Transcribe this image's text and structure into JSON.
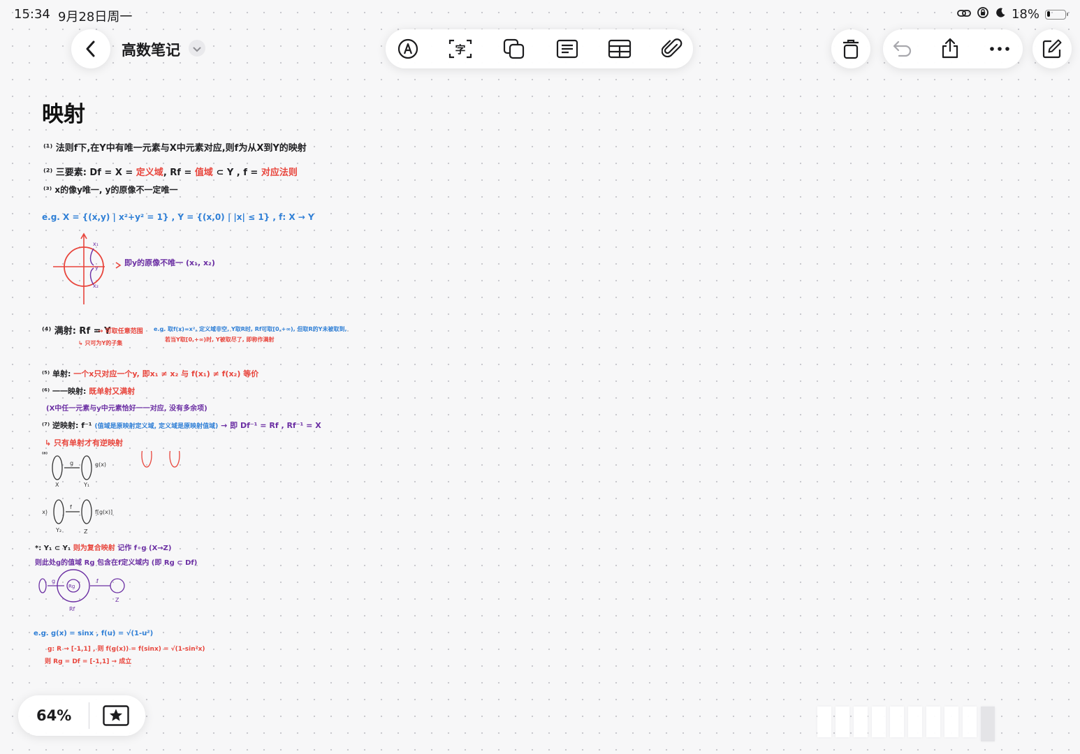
{
  "status_bar": {
    "time": "15:34",
    "date": "9月28日周一",
    "battery_percent": "18%",
    "battery_level": 0.18
  },
  "header": {
    "back_icon": "chevron-left-icon",
    "document_name": "高数笔记",
    "name_menu_icon": "chevron-down-icon"
  },
  "toolbar": {
    "tools": [
      {
        "name": "markup",
        "icon": "pen-circle-icon"
      },
      {
        "name": "text-recognition",
        "icon": "text-box-icon",
        "glyph": "字"
      },
      {
        "name": "shapes",
        "icon": "shapes-icon"
      },
      {
        "name": "text-box",
        "icon": "text-block-icon"
      },
      {
        "name": "table",
        "icon": "table-icon"
      },
      {
        "name": "attachment",
        "icon": "paperclip-icon"
      }
    ]
  },
  "right_actions": {
    "icons": [
      "trash-icon",
      "undo-icon",
      "share-icon",
      "more-icon",
      "compose-icon"
    ]
  },
  "note": {
    "title": "映射",
    "lines": {
      "l1": "⁽¹⁾ 法则f下,在Y中有唯一元素与X中元素对应,则f为从X到Y的映射",
      "l2a": "⁽²⁾ 三要素: Df = X = ",
      "l2b": "定义域",
      "l2c": ", Rf = ",
      "l2d": "值域",
      "l2e": " ⊂ Y , f = ",
      "l2f": "对应法则",
      "l3": "⁽³⁾ x的像y唯一, y的原像不一定唯一",
      "eg1": "e.g. X = {(x,y) | x²+y² = 1} , Y = {(x,0) | |x| ≤ 1} , f: X → Y",
      "diagram1_label": "即y的原像不唯一 (x₁, x₂)",
      "surj_title": "⁽⁴⁾ 满射: Rf = Y",
      "surj_red1": "→ 可取任意范围",
      "surj_red2": "↳ 只可为Y的子集",
      "surj_eg1": "e.g. 取f(x)=x², 定义域非空, Y取R时, Rf可取[0,+∞), 但取R的Y未被取到,",
      "surj_eg2": "若当Y取[0,+∞)时, Y被取尽了, 即称作满射",
      "inj_num": "⁽⁵⁾ 单射: ",
      "inj_red": "一个x只对应一个y, 即x₁ ≠ x₂ 与 f(x₁) ≠ f(x₂) 等价",
      "bij_num": "⁽⁶⁾ 一一映射: ",
      "bij_red": "既单射又满射",
      "bij_note": "(X中任一元素与y中元素恰好一一对应, 没有多余项)",
      "inv_title": "⁽⁷⁾ 逆映射: f⁻¹ ",
      "inv_blue": "(值域是原映射定义域, 定义域是原映射值域)",
      "inv_eq": " → 即 Df⁻¹ = Rf , Rf⁻¹ = X",
      "inv_note": "↳ 只有单射才有逆映射",
      "comp_num": "⁽⁸⁾",
      "comp_note1_a": "*: Y₁ ⊂ Y₁ ",
      "comp_note1_b": "则为复合映射",
      "comp_note1_c": " 记作 f∘g (X→Z)",
      "comp_note2": "则此处g的值域 Rg 包含在f定义域内 (即 Rg ⊂ Df)",
      "eg2_a": "e.g. g(x) = sinx , f(u) = √(1-u²)",
      "eg2_b": "g: R → [-1,1] , 则 f(g(x)) = f(sinx) = √(1-sin²x)",
      "eg2_c": "则 Rg = Df = [-1,1] → 成立"
    },
    "diagram_labels": {
      "x1": "x₁",
      "x2": "x₂",
      "y": "y",
      "g": "g",
      "f": "f",
      "f_inv": "f⁻¹",
      "gx": "g(x)",
      "fgx": "f[g(x)]",
      "X": "X",
      "Y1": "Y₁",
      "Y2": "Y₂",
      "Z": "Z",
      "Rf": "Rf",
      "Rg": "Rg",
      "x": "x"
    }
  },
  "bottom_bar": {
    "zoom": "64%",
    "favorite_icon": "star-box-icon"
  },
  "page_scrubber": {
    "pages": 10,
    "current": 9
  }
}
